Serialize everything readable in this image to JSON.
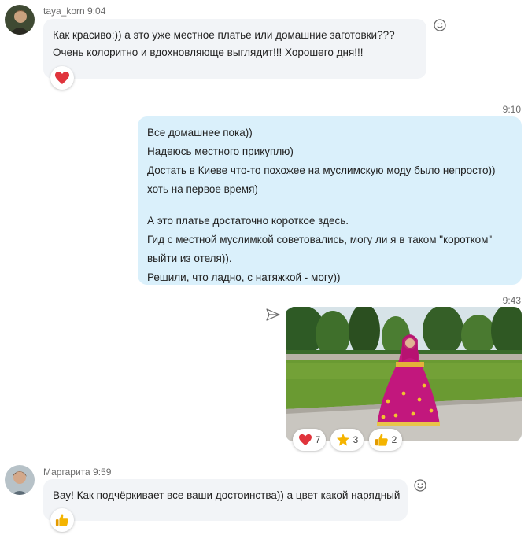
{
  "messages": [
    {
      "author": "taya_korn",
      "time": "9:04",
      "lines": [
        "Как красиво:)) а это уже местное платье или домашние заготовки???",
        "Очень колоритно и вдохновляюще выглядит!!! Хорошего дня!!!"
      ],
      "reaction": "heart"
    },
    {
      "time": "9:10",
      "lines": [
        "Все домашнее пока))",
        "Надеюсь местного прикуплю)",
        "Достать в Киеве что-то похожее на муслимскую моду было непросто))",
        "хоть на первое время)",
        "",
        "А это платье достаточно короткое здесь.",
        "Гид с местной муслимкой советовались, могу ли я в таком \"коротком\"",
        "выйти из отеля)).",
        "Решили, что ладно, с натяжкой - могу))"
      ]
    },
    {
      "time": "9:43",
      "reactions": [
        {
          "icon": "heart",
          "count": "7"
        },
        {
          "icon": "star",
          "count": "3"
        },
        {
          "icon": "thumbs-up",
          "count": "2"
        }
      ]
    },
    {
      "author": "Маргарита",
      "time": "9:59",
      "lines": [
        "Вау! Как подчёркивает все ваши достоинства)) а цвет какой нарядный"
      ],
      "reaction": "thumbs-up"
    }
  ],
  "colors": {
    "incoming_bubble": "#f2f4f7",
    "outgoing_bubble": "#daf0fb",
    "heart": "#e0343c",
    "star": "#f5b400",
    "thumb": "#f4b400"
  }
}
